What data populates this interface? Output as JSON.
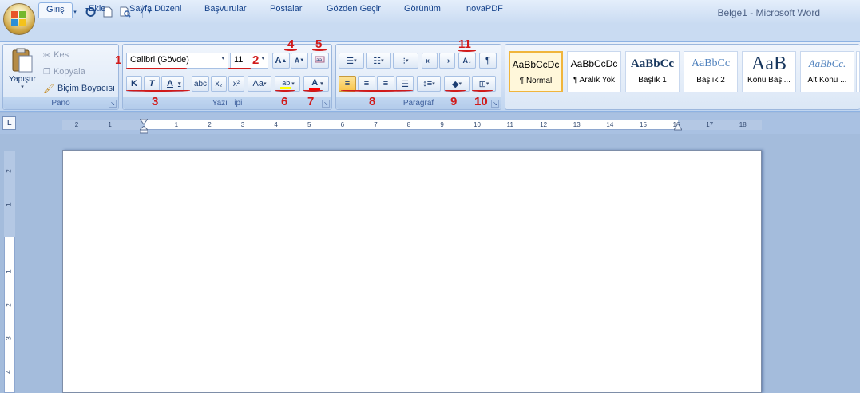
{
  "window": {
    "title": "Belge1 - Microsoft Word"
  },
  "qat": {
    "icons": [
      "save-icon",
      "undo-icon",
      "redo-icon",
      "new-document-icon",
      "print-preview-icon",
      "customize-qat-icon"
    ]
  },
  "tabs": [
    "Giriş",
    "Ekle",
    "Sayfa Düzeni",
    "Başvurular",
    "Postalar",
    "Gözden Geçir",
    "Görünüm",
    "novaPDF"
  ],
  "clipboard": {
    "paste_label": "Yapıştır",
    "cut_label": "Kes",
    "copy_label": "Kopyala",
    "format_painter_label": "Biçim Boyacısı",
    "group_label": "Pano"
  },
  "font": {
    "font_name": "Calibri (Gövde)",
    "font_size": "11",
    "bold": "K",
    "italic": "T",
    "underline": "A",
    "strikethrough": "abc",
    "subscript": "x₂",
    "superscript": "x²",
    "change_case": "Aa",
    "grow": "A",
    "shrink": "A",
    "group_label": "Yazı Tipi",
    "highlight": "ab",
    "font_color": "A"
  },
  "paragraph": {
    "group_label": "Paragraf",
    "pilcrow": "¶"
  },
  "styles": [
    {
      "sample": "AaBbCcDc",
      "name": "¶ Normal"
    },
    {
      "sample": "AaBbCcDc",
      "name": "¶ Aralık Yok"
    },
    {
      "sample": "AaBbCc",
      "name": "Başlık 1"
    },
    {
      "sample": "AaBbCc",
      "name": "Başlık 2"
    },
    {
      "sample": "AaB",
      "name": "Konu Başl..."
    },
    {
      "sample": "AaBbCc.",
      "name": "Alt Konu ..."
    }
  ],
  "annotations": [
    "1",
    "2",
    "3",
    "4",
    "5",
    "6",
    "7",
    "8",
    "9",
    "10",
    "11"
  ],
  "ruler": {
    "h_ticks": [
      "2",
      "1",
      "1",
      "2",
      "3",
      "4",
      "5",
      "6",
      "7",
      "8",
      "9",
      "10",
      "11",
      "12",
      "13",
      "14",
      "15",
      "16",
      "17",
      "18"
    ],
    "v_ticks": [
      "2",
      "1",
      "1",
      "2",
      "3",
      "4"
    ]
  },
  "colors": {
    "highlight": "#ffff00",
    "font_color": "#ff0000",
    "annotation": "#d11a1a"
  }
}
